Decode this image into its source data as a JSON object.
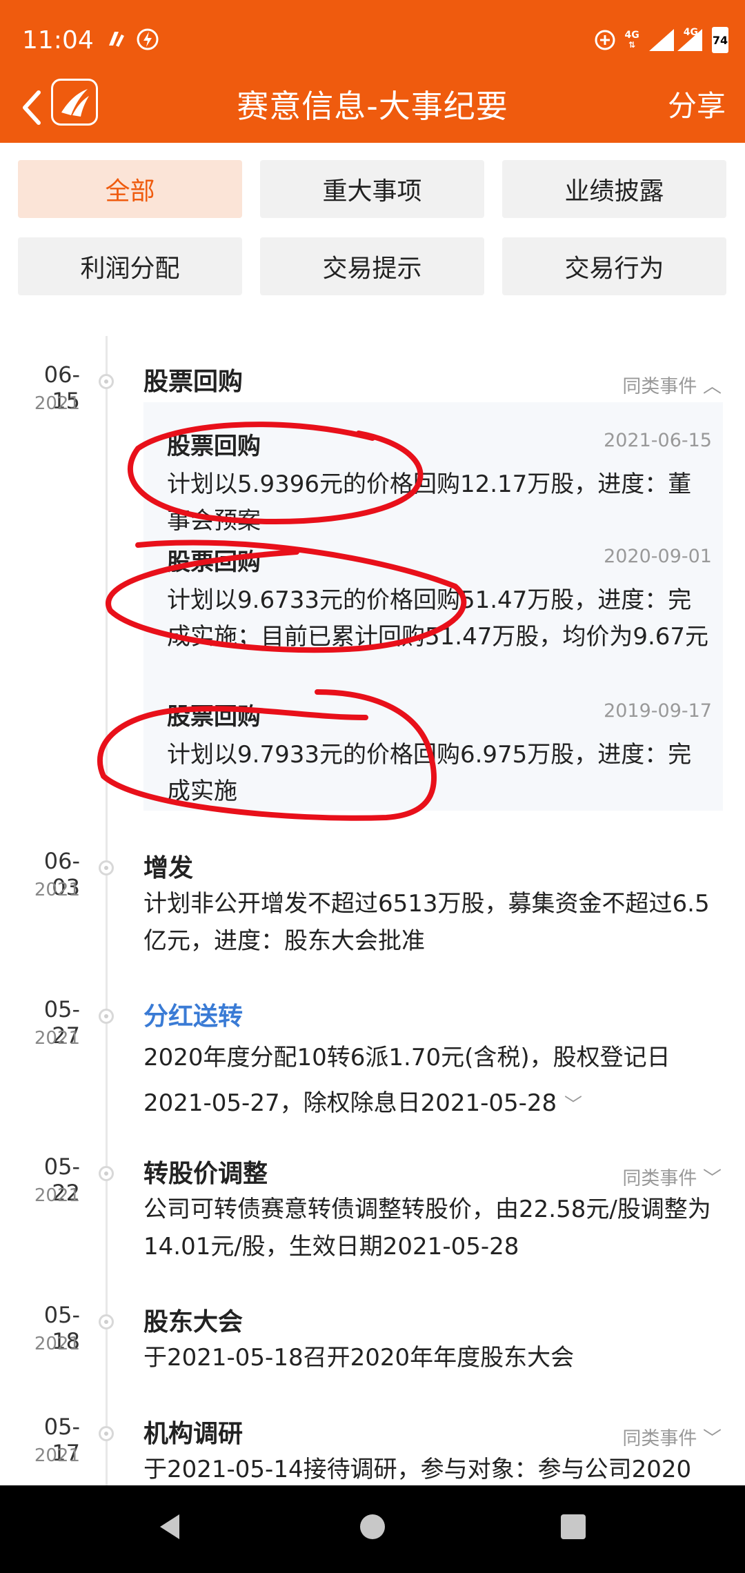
{
  "status_bar": {
    "time": "11:04",
    "network1": "4G",
    "network2": "4G",
    "battery": "74"
  },
  "header": {
    "title": "赛意信息-大事纪要",
    "share": "分享"
  },
  "filters": [
    "全部",
    "重大事项",
    "业绩披露",
    "利润分配",
    "交易提示",
    "交易行为"
  ],
  "events": [
    {
      "month_day": "06-15",
      "year": "2021",
      "title": "股票回购",
      "same_type": "同类事件",
      "sub_items": [
        {
          "title": "股票回购",
          "date": "2021-06-15",
          "desc": "计划以5.9396元的价格回购12.17万股，进度：董事会预案"
        },
        {
          "title": "股票回购",
          "date": "2020-09-01",
          "desc": "计划以9.6733元的价格回购51.47万股，进度：完成实施；目前已累计回购51.47万股，均价为9.67元"
        },
        {
          "title": "股票回购",
          "date": "2019-09-17",
          "desc": "计划以9.7933元的价格回购6.975万股，进度：完成实施"
        }
      ]
    },
    {
      "month_day": "06-03",
      "year": "2021",
      "title": "增发",
      "desc": "计划非公开增发不超过6513万股，募集资金不超过6.5亿元，进度：股东大会批准"
    },
    {
      "month_day": "05-27",
      "year": "2021",
      "title": "分红送转",
      "desc": "2020年度分配10转6派1.70元(含税)，股权登记日2021-05-27，除权除息日2021-05-28"
    },
    {
      "month_day": "05-22",
      "year": "2021",
      "title": "转股价调整",
      "same_type": "同类事件",
      "desc": "公司可转债赛意转债调整转股价，由22.58元/股调整为14.01元/股，生效日期2021-05-28"
    },
    {
      "month_day": "05-18",
      "year": "2021",
      "title": "股东大会",
      "desc": "于2021-05-18召开2020年年度股东大会"
    },
    {
      "month_day": "05-17",
      "year": "2021",
      "title": "机构调研",
      "same_type": "同类事件",
      "desc": "于2021-05-14接待调研，参与对象：参与公司2020"
    }
  ],
  "colors": {
    "brand": "#ef5b0e",
    "link": "#3a7bd5",
    "annotation": "#e8101a"
  }
}
